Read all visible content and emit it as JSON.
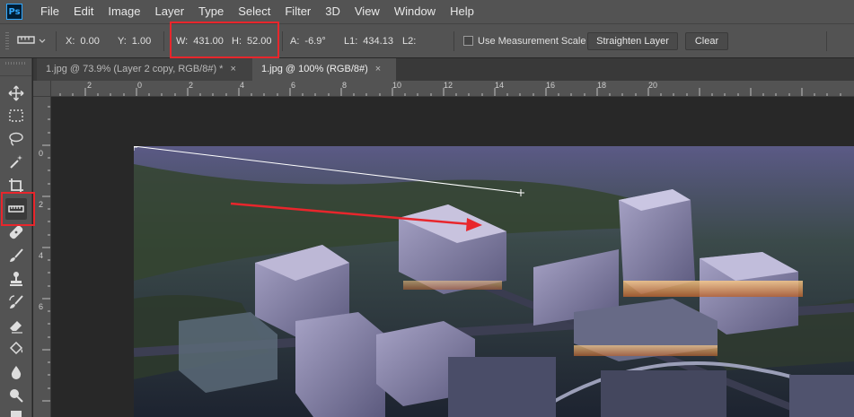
{
  "menubar": {
    "logo": "Ps",
    "items": [
      "File",
      "Edit",
      "Image",
      "Layer",
      "Type",
      "Select",
      "Filter",
      "3D",
      "View",
      "Window",
      "Help"
    ]
  },
  "options": {
    "x_label": "X:",
    "x_value": "0.00",
    "y_label": "Y:",
    "y_value": "1.00",
    "w_label": "W:",
    "w_value": "431.00",
    "h_label": "H:",
    "h_value": "52.00",
    "a_label": "A:",
    "a_value": "-6.9°",
    "l1_label": "L1:",
    "l1_value": "434.13",
    "l2_label": "L2:",
    "l2_value": "",
    "measurement_scale_label": "Use Measurement Scale",
    "measurement_scale_checked": false,
    "straighten_label": "Straighten Layer",
    "clear_label": "Clear"
  },
  "tabs": [
    {
      "label": "1.jpg @ 73.9% (Layer 2 copy, RGB/8#) *",
      "close": "×",
      "active": false
    },
    {
      "label": "1.jpg @ 100% (RGB/8#)",
      "close": "×",
      "active": true
    }
  ],
  "ruler_h_labels": [
    "2",
    "0",
    "2",
    "4",
    "6",
    "8",
    "10",
    "12",
    "14",
    "16",
    "18",
    "20"
  ],
  "ruler_v_labels": [
    "0",
    "2",
    "4",
    "6"
  ],
  "colors": {
    "highlight": "#e8262c",
    "ui_dark": "#535353",
    "workspace": "#282828"
  },
  "icons": [
    "move-icon",
    "marquee-icon",
    "lasso-icon",
    "magic-wand-icon",
    "crop-icon",
    "ruler-icon",
    "healing-brush-icon",
    "brush-icon",
    "stamp-icon",
    "history-brush-icon",
    "eraser-icon",
    "paint-bucket-icon",
    "blur-icon",
    "dodge-icon",
    "pen-icon"
  ]
}
